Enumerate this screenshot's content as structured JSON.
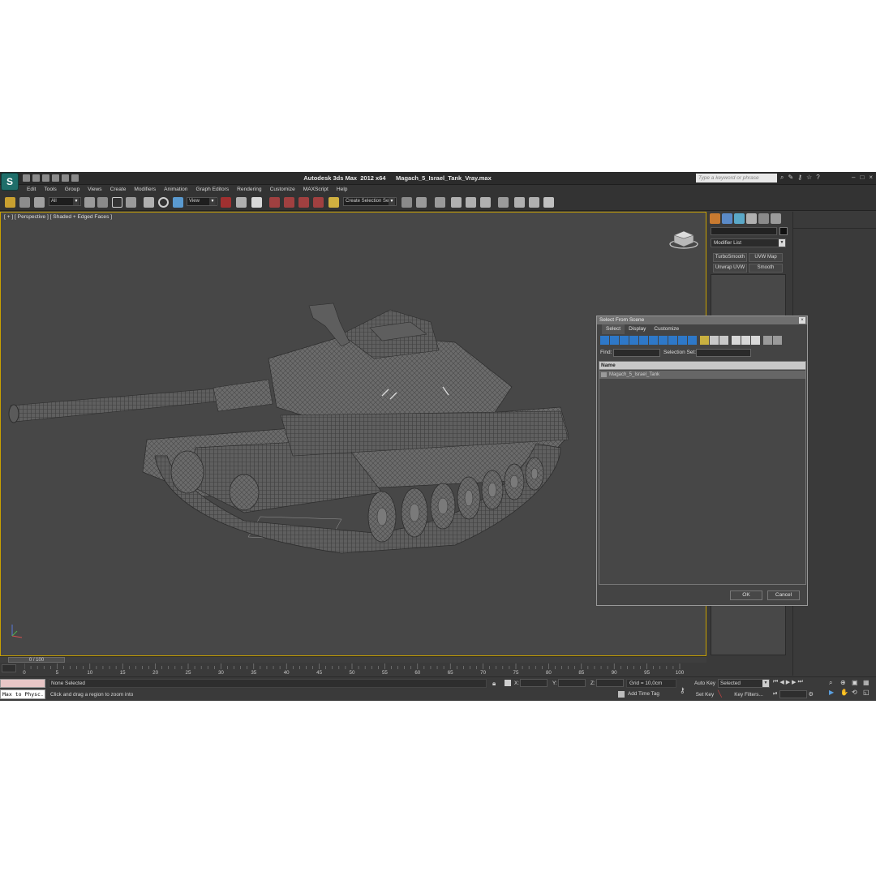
{
  "app": {
    "logo": "S",
    "title": "Autodesk 3ds Max  2012 x64      Magach_5_Israel_Tank_Vray.max",
    "search_placeholder": "Type a keyword or phrase"
  },
  "menu": [
    "Edit",
    "Tools",
    "Group",
    "Views",
    "Create",
    "Modifiers",
    "Animation",
    "Graph Editors",
    "Rendering",
    "Customize",
    "MAXScript",
    "Help"
  ],
  "toolbar": {
    "selection_filter": "All",
    "ref_coord": "View",
    "named_selection": "Create Selection Se"
  },
  "viewport": {
    "label": "[ + ] [ Perspective ] [ Shaded + Edged Faces ]"
  },
  "command_panel": {
    "modifier_list": "Modifier List",
    "buttons": [
      "TurboSmooth",
      "UVW Map",
      "Unwrap UVW",
      "Smooth"
    ]
  },
  "dialog": {
    "title": "Select From Scene",
    "close": "×",
    "menu": [
      "Select",
      "Display",
      "Customize"
    ],
    "find_label": "Find:",
    "selection_set_label": "Selection Set:",
    "column_header": "Name",
    "items": [
      "Magach_5_Israel_Tank"
    ],
    "ok": "OK",
    "cancel": "Cancel"
  },
  "timeline": {
    "frame_display": "0 / 100",
    "ticks": [
      "0",
      "5",
      "10",
      "15",
      "20",
      "25",
      "30",
      "35",
      "40",
      "45",
      "50",
      "55",
      "60",
      "65",
      "70",
      "75",
      "80",
      "85",
      "90",
      "95",
      "100"
    ]
  },
  "status": {
    "listener": "Max to Physc.",
    "selection": "None Selected",
    "prompt": "Click and drag a region to zoom into",
    "x_label": "X:",
    "y_label": "Y:",
    "z_label": "Z:",
    "grid": "Grid = 10,0cm",
    "add_time_tag": "Add Time Tag",
    "auto_key": "Auto Key",
    "set_key": "Set Key",
    "key_mode": "Selected",
    "key_filters": "Key Filters..."
  },
  "colors": {
    "viewport_border": "#c8a000",
    "dialog_toolbar_blue": "#2e78c8"
  }
}
